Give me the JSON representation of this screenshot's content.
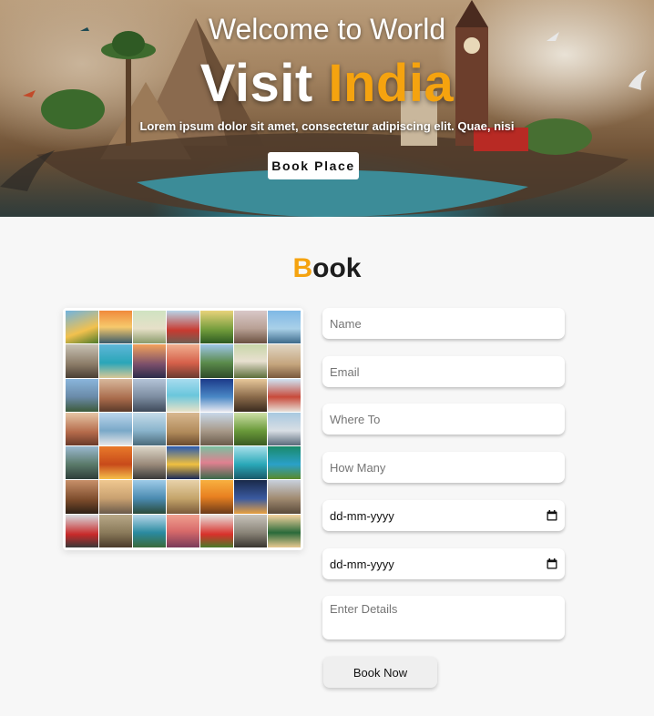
{
  "hero": {
    "subtitle": "Welcome to World",
    "title_main": "Visit",
    "title_accent": "India",
    "tagline": "Lorem ipsum dolor sit amet, consectetur adipiscing elit. Quae, nisi",
    "button_label": "Book Place"
  },
  "book": {
    "heading_first": "B",
    "heading_rest": "ook",
    "fields": {
      "name_placeholder": "Name",
      "email_placeholder": "Email",
      "where_placeholder": "Where To",
      "howmany_placeholder": "How Many",
      "date1_value": "dd-mm-yyyy",
      "date2_value": "dd-mm-yyyy",
      "details_placeholder": "Enter Details"
    },
    "submit_label": "Book Now"
  },
  "colors": {
    "accent": "#f5a30f",
    "page_bg": "#f7f7f7"
  },
  "icons": [
    "calendar-icon"
  ]
}
